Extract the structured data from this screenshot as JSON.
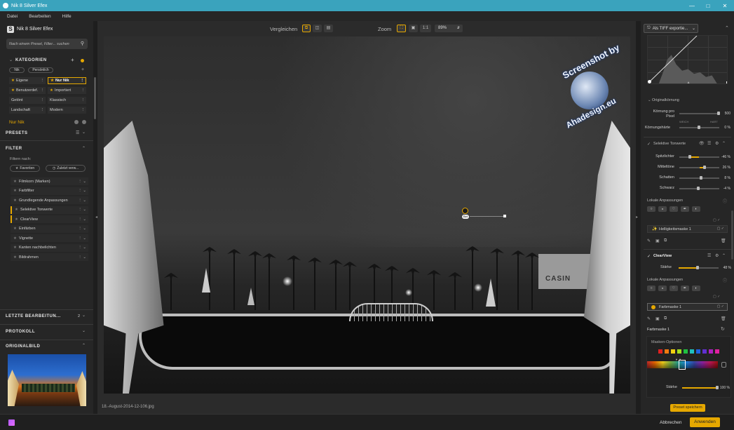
{
  "window": {
    "title": "Nik 8 Silver Efex"
  },
  "menu": [
    "Datei",
    "Bearbeiten",
    "Hilfe"
  ],
  "left": {
    "app_name": "Nik 8 Silver Efex",
    "search_placeholder": "Nach einem Preset, Filter... suchen",
    "categories_header": "KATEGORIEN",
    "tags": [
      "Nik",
      "Persönlich"
    ],
    "categories": [
      {
        "label": "Eigene",
        "star": true
      },
      {
        "label": "Nur Nik",
        "star": true,
        "selected": true
      },
      {
        "label": "Benutzerdef.",
        "star": true
      },
      {
        "label": "Importiert",
        "star": true
      },
      {
        "label": "Getönt",
        "star": false
      },
      {
        "label": "Klassisch",
        "star": false
      },
      {
        "label": "Landschaft",
        "star": false
      },
      {
        "label": "Modern",
        "star": false
      }
    ],
    "active_category": "Nur Nik",
    "presets_header": "PRESETS",
    "filter_header": "FILTER",
    "filter_by": "Filtern nach:",
    "favorites_btn": "Favoriten",
    "recent_btn": "Zuletzt verw...",
    "filters": [
      "Filmkorn (Marken)",
      "Farbfilter",
      "Grundlegende Anpassungen",
      "Selektive Tonwerte",
      "ClearView",
      "Einfärben",
      "Vignette",
      "Kanten nachbelichten",
      "Bildrahmen"
    ],
    "last_edits_header": "LETZTE BEARBEITUN...",
    "last_edits_count": "2",
    "protocol_header": "PROTOKOLL",
    "original_header": "ORIGINALBILD"
  },
  "center": {
    "compare_label": "Vergleichen",
    "zoom_label": "Zoom",
    "zoom_11": "1:1",
    "zoom_value": "89%",
    "filename": "18.-August-2014-12-106.jpg",
    "watermark_top": "Screenshot by",
    "watermark_bottom": "Ahadesign.eu",
    "control_point_label": "Bet"
  },
  "right": {
    "export_btn": "Als TIFF exportie...",
    "orig_grain_header": "Originalkörnung",
    "grain_per_pixel_label": "Körnung pro Pixel",
    "grain_per_pixel_value": "500",
    "soft_label": "WEICH",
    "hard_label": "HART",
    "grain_hardness_label": "Körnungshärte",
    "grain_hardness_value": "0 %",
    "selective_header": "Selektive Tonwerte",
    "tones": [
      {
        "label": "Spitzlichter",
        "value": "-46 %",
        "fill": 0.27
      },
      {
        "label": "Mitteltöne",
        "value": "26 %",
        "fill": 0.63
      },
      {
        "label": "Schatten",
        "value": "8 %",
        "fill": 0.54
      },
      {
        "label": "Schwarz",
        "value": "-4 %",
        "fill": 0.48
      }
    ],
    "local_adj_label": "Lokale Anpassungen",
    "brightness_mask": "Helligkeitsmaske 1",
    "clearview_header": "ClearView",
    "strength_label": "Stärke",
    "clearview_strength": "48 %",
    "clearview_fill": 0.48,
    "local_adj_label2": "Lokale Anpassungen",
    "color_mask": "Farbmaske 1",
    "color_mask_label": "Farbmaske 1",
    "mask_options": "Masken-Optionen",
    "swatches": [
      "#e02020",
      "#f07a10",
      "#f0d010",
      "#a0e020",
      "#20c040",
      "#20c0c0",
      "#2060e0",
      "#6030d0",
      "#b020c0",
      "#e020a0"
    ],
    "strength_label2": "Stärke",
    "mask_strength": "100 %",
    "mask_strength_fill": 1.0,
    "save_preset_btn": "Preset speichern"
  },
  "bottom": {
    "cancel_btn": "Abbrechen",
    "apply_btn": "Anwenden"
  },
  "colors": {
    "accent": "#e6a800",
    "titlebar": "#3aa3bd"
  }
}
